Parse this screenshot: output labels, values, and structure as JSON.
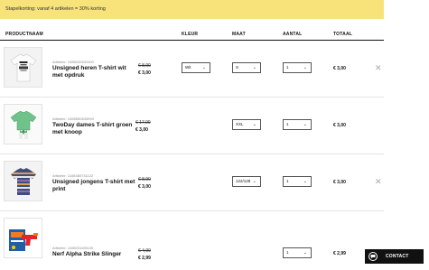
{
  "banner": {
    "text": "Stapelkorting: vanaf 4 artikelen = 30% korting"
  },
  "table": {
    "headers": {
      "product": "PRODUCTNAAM",
      "color": "KLEUR",
      "size": "MAAT",
      "qty": "AANTAL",
      "total": "TOTAAL"
    }
  },
  "rows": [
    {
      "article": "Artikelnr: 1085432631000",
      "name": "Unsigned heren T-shirt wit met opdruk",
      "old_price": "€ 8,99",
      "new_price": "€ 3,00",
      "color": "Wit",
      "size": "S",
      "qty": "1",
      "total": "€ 3,00",
      "image": "white-printed-tshirt"
    },
    {
      "article": "Artikelnr: 1085550633990",
      "name": "TwoDay dames T-shirt groen met knoop",
      "old_price": "€ 17,99",
      "new_price": "€ 3,00",
      "color": "",
      "size": "XXL",
      "qty": "1",
      "total": "€ 3,00",
      "image": "green-knot-tshirt"
    },
    {
      "article": "Artikelnr: 1108480731122",
      "name": "Unsigned jongens T-shirt met print",
      "old_price": "€ 8,99",
      "new_price": "€ 3,00",
      "color": "",
      "size": "122/128",
      "qty": "1",
      "total": "€ 3,00",
      "image": "striped-boys-tshirt"
    },
    {
      "article": "Artikelnr: 1108031106100",
      "name": "Nerf Alpha Strike Slinger",
      "old_price": "€ 4,99",
      "new_price": "€ 2,99",
      "color": "",
      "size": "",
      "qty": "1",
      "total": "€ 2,99",
      "image": "nerf-blaster-toy"
    }
  ],
  "contact": {
    "label": "CONTACT",
    "icon": "chat-icon"
  },
  "colors": {
    "banner": "#f8e27a",
    "contact_bg": "#111111"
  }
}
